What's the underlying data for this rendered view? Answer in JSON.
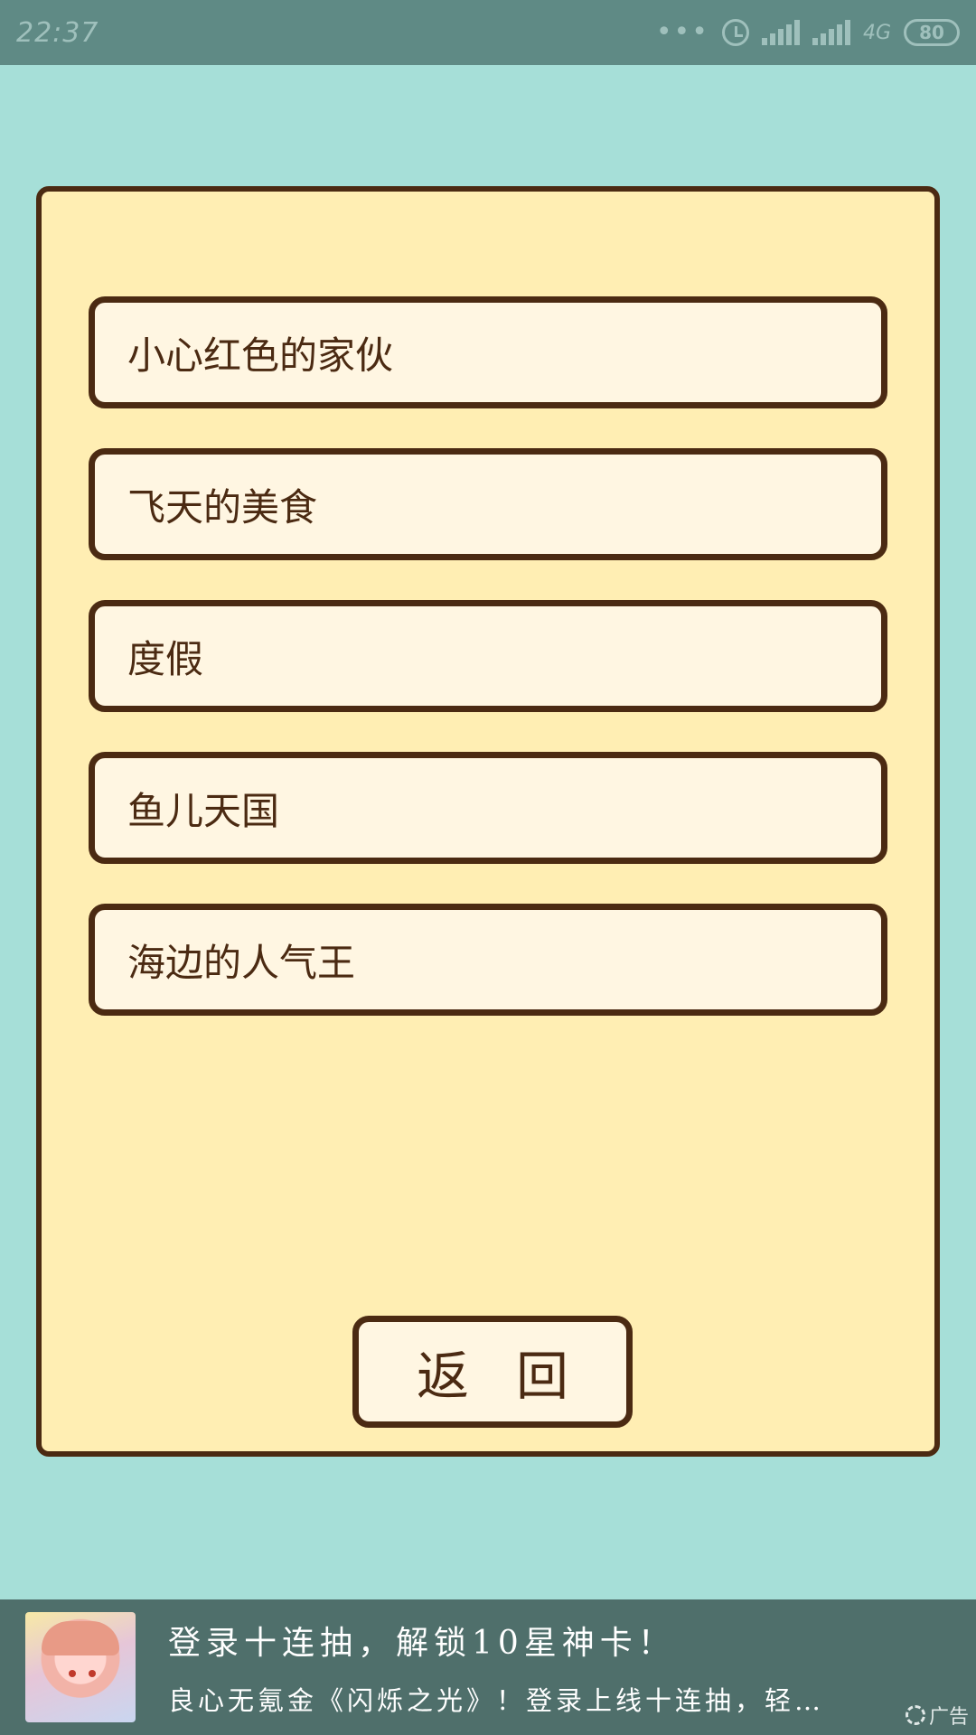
{
  "status_bar": {
    "time": "22:37",
    "network": "4G",
    "battery": "80"
  },
  "levels": [
    {
      "label": "小心红色的家伙"
    },
    {
      "label": "飞天的美食"
    },
    {
      "label": "度假"
    },
    {
      "label": "鱼儿天国"
    },
    {
      "label": "海边的人气王"
    }
  ],
  "back_label": "返回",
  "ad": {
    "title": "登录十连抽，解锁10星神卡！",
    "description": "良心无氪金《闪烁之光》！登录上线十连抽，轻…",
    "label": "广告"
  },
  "colors": {
    "background": "#a6dfd8",
    "panel": "#ffeeb3",
    "button": "#fff6e2",
    "border": "#4b2a12",
    "status_bar": "#5f8a85",
    "ad_banner": "#4f6f6b"
  }
}
